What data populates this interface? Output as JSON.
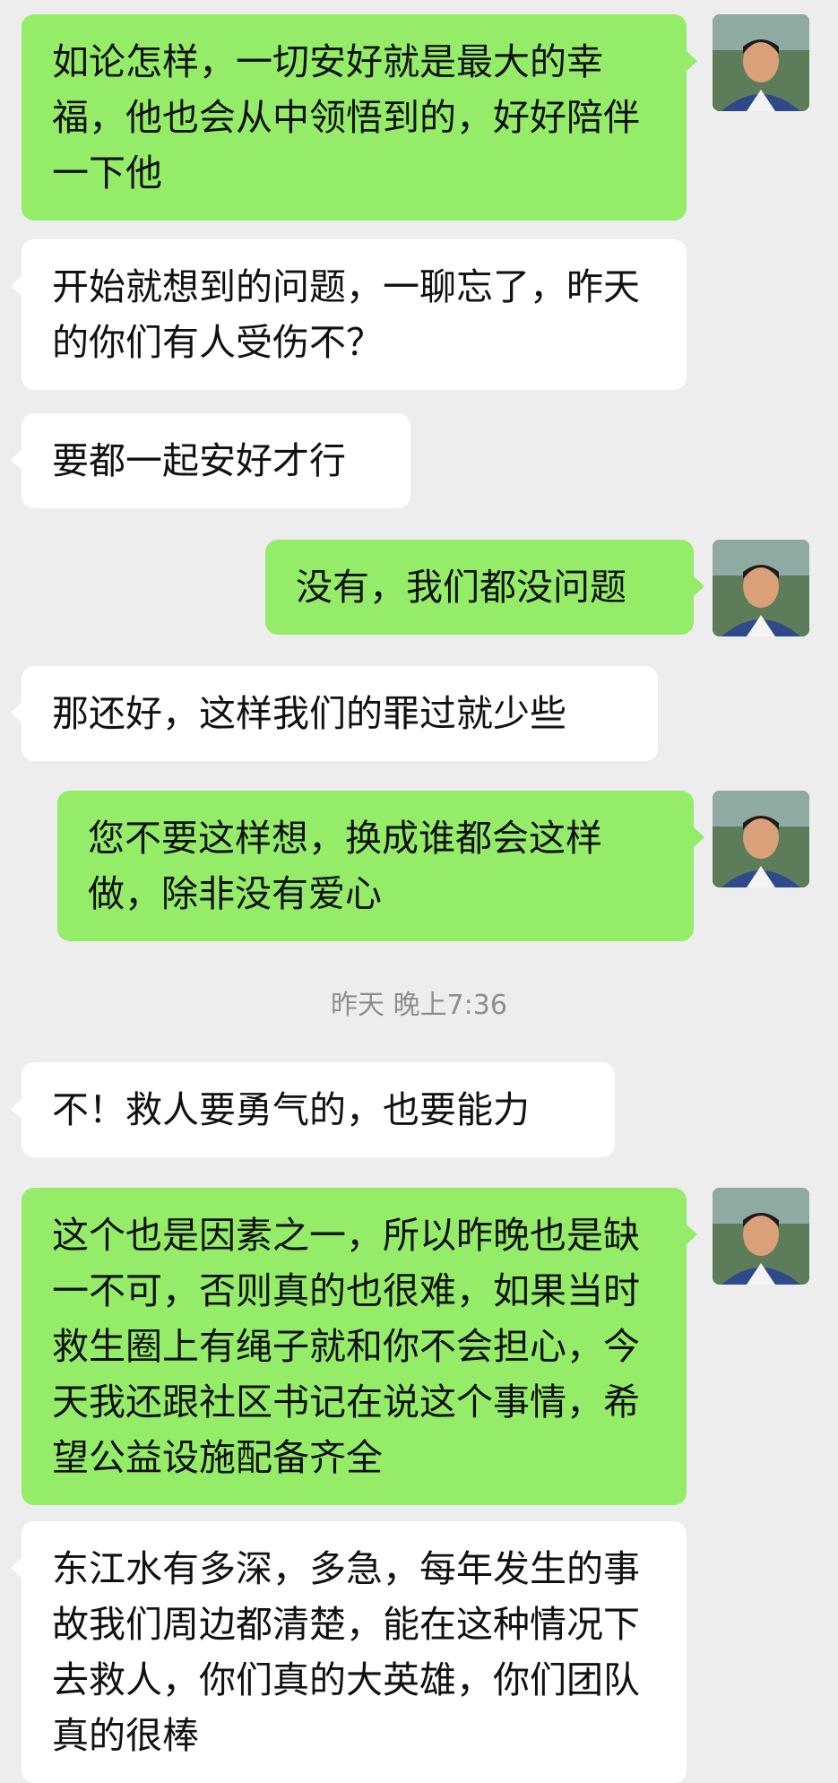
{
  "messages": [
    {
      "type": "text",
      "sender": "self",
      "text": "如论怎样，一切安好就是最大的幸福，他也会从中领悟到的，好好陪伴一下他"
    },
    {
      "type": "text",
      "sender": "other",
      "text": "开始就想到的问题，一聊忘了，昨天的你们有人受伤不？"
    },
    {
      "type": "text",
      "sender": "other",
      "text": "要都一起安好才行"
    },
    {
      "type": "text",
      "sender": "self",
      "text": "没有，我们都没问题"
    },
    {
      "type": "text",
      "sender": "other",
      "text": "那还好，这样我们的罪过就少些"
    },
    {
      "type": "text",
      "sender": "self",
      "text": "您不要这样想，换成谁都会这样做，除非没有爱心"
    },
    {
      "type": "timestamp",
      "text": "昨天 晚上7:36"
    },
    {
      "type": "text",
      "sender": "other",
      "text": "不！救人要勇气的，也要能力"
    },
    {
      "type": "text",
      "sender": "self",
      "text": "这个也是因素之一，所以昨晚也是缺一不可，否则真的也很难，如果当时救生圈上有绳子就和你不会担心，今天我还跟社区书记在说这个事情，希望公益设施配备齐全"
    },
    {
      "type": "text",
      "sender": "other",
      "text": "东江水有多深，多急，每年发生的事故我们周边都清楚，能在这种情况下去救人，你们真的大英雄，你们团队真的很棒"
    }
  ],
  "colors": {
    "background": "#ededed",
    "bubble_self": "#95ec69",
    "bubble_other": "#ffffff",
    "timestamp": "#8e8e8e"
  },
  "icons": {
    "avatar_self": "user-avatar-photo"
  }
}
